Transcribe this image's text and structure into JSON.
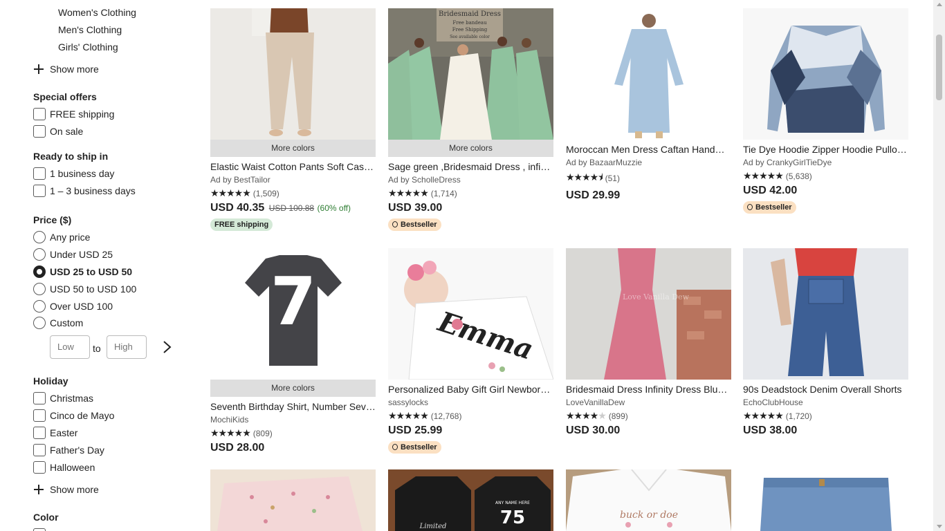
{
  "sidebar": {
    "categories": [
      "Women's Clothing",
      "Men's Clothing",
      "Girls' Clothing"
    ],
    "show_more": "Show more",
    "special_offers": {
      "title": "Special offers",
      "options": [
        "FREE shipping",
        "On sale"
      ]
    },
    "ready_to_ship": {
      "title": "Ready to ship in",
      "options": [
        "1 business day",
        "1 – 3 business days"
      ]
    },
    "price": {
      "title": "Price ($)",
      "options": [
        "Any price",
        "Under USD 25",
        "USD 25 to USD 50",
        "USD 50 to USD 100",
        "Over USD 100",
        "Custom"
      ],
      "selected": "USD 25 to USD 50",
      "low_placeholder": "Low",
      "high_placeholder": "High",
      "to_label": "to"
    },
    "holiday": {
      "title": "Holiday",
      "options": [
        "Christmas",
        "Cinco de Mayo",
        "Easter",
        "Father's Day",
        "Halloween"
      ]
    },
    "show_more_2": "Show more",
    "color": {
      "title": "Color"
    }
  },
  "products": [
    {
      "title": "Elastic Waist Cotton Pants Soft Casual Trousers",
      "shop": "Ad by BestTailor",
      "stars": 5,
      "reviews": "(1,509)",
      "price": "USD 40.35",
      "original": "USD 100.88",
      "discount": "(60% off)",
      "more_colors": "More colors",
      "badge": "FREE shipping"
    },
    {
      "title": "Sage green ,Bridesmaid Dress , infinity dress",
      "shop": "Ad by ScholleDress",
      "stars": 5,
      "reviews": "(1,714)",
      "price": "USD 39.00",
      "more_colors": "More colors",
      "badge": "Bestseller",
      "img_text": [
        "Bridesmaid Dress",
        "Free bandeau",
        "Free Shipping",
        "See available color"
      ]
    },
    {
      "title": "Moroccan Men Dress Caftan Handmade",
      "shop": "Ad by BazaarMuzzie",
      "stars": 4.5,
      "reviews": "(51)",
      "price": "USD 29.99"
    },
    {
      "title": "Tie Dye Hoodie Zipper Hoodie Pullover",
      "shop": "Ad by CrankyGirlTieDye",
      "stars": 5,
      "reviews": "(5,638)",
      "price": "USD 42.00",
      "badge": "Bestseller"
    },
    {
      "title": "Seventh Birthday Shirt, Number Seven Shirt",
      "shop": "MochiKids",
      "stars": 5,
      "reviews": "(809)",
      "price": "USD 28.00",
      "more_colors": "More colors",
      "img_text": "7"
    },
    {
      "title": "Personalized Baby Gift Girl Newborn Gown",
      "shop": "sassylocks",
      "stars": 5,
      "reviews": "(12,768)",
      "price": "USD 25.99",
      "badge": "Bestseller",
      "img_text": "Emma"
    },
    {
      "title": "Bridesmaid Dress Infinity Dress Blush Pink",
      "shop": "LoveVanillaDew",
      "stars": 4,
      "reviews": "(899)",
      "price": "USD 30.00",
      "img_text": "Love Vanilla Dew"
    },
    {
      "title": "90s Deadstock Denim Overall Shorts",
      "shop": "EchoClubHouse",
      "stars": 5,
      "reviews": "(1,720)",
      "price": "USD 38.00"
    }
  ],
  "row3_img_text": {
    "hoodie_left": "Limited",
    "hoodie_right": "ANY NAME HERE",
    "hoodie_number": "75",
    "shirt": "buck or doe"
  },
  "colors": {
    "free_badge": "#d4e9d7",
    "bestseller_badge": "#fbe0c2",
    "sale_green": "#2e7d32"
  }
}
